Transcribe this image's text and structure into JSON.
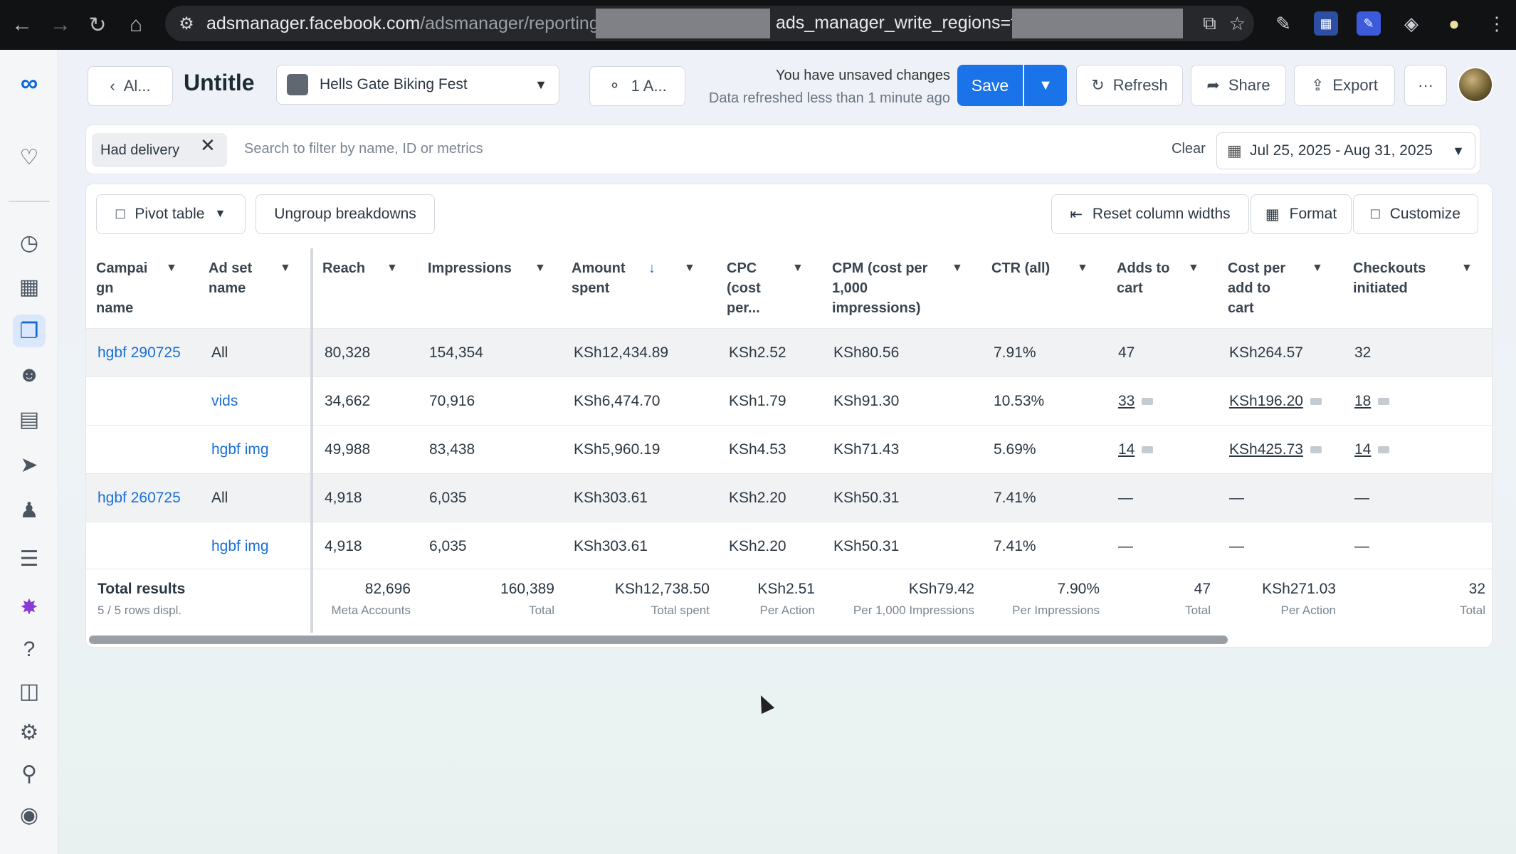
{
  "browser": {
    "url_host": "adsmanager.facebook.com",
    "url_path": "/adsmanager/reporting/view?",
    "url_mid": "ads_manager_write_regions=true"
  },
  "header": {
    "back_label": "Al...",
    "title": "Untitle",
    "campaign_select": "Hells Gate Biking Fest",
    "account_label": "1 A...",
    "unsaved_text": "You have unsaved changes",
    "refreshed_text": "Data refreshed less than 1 minute ago",
    "save_label": "Save",
    "refresh_label": "Refresh",
    "share_label": "Share",
    "export_label": "Export",
    "more_label": "···"
  },
  "filter": {
    "chip_label": "Had delivery",
    "search_placeholder": "Search to filter by name, ID or metrics",
    "clear_label": "Clear",
    "date_range": "Jul 25, 2025 - Aug 31, 2025"
  },
  "toolbar": {
    "pivot_label": "Pivot table",
    "ungroup_label": "Ungroup breakdowns",
    "reset_label": "Reset column widths",
    "format_label": "Format",
    "customize_label": "Customize"
  },
  "columns": [
    "Campai gn name",
    "Ad set name",
    "Reach",
    "Impressions",
    "Amount spent",
    "CPC (cost per...",
    "CPM (cost per 1,000 impressions)",
    "CTR (all)",
    "Adds to cart",
    "Cost per add to cart",
    "Checkouts initiated"
  ],
  "rows": [
    {
      "campaign": "hgbf 290725",
      "adset": "All",
      "reach": "80,328",
      "impressions": "154,354",
      "spent": "KSh12,434.89",
      "cpc": "KSh2.52",
      "cpm": "KSh80.56",
      "ctr": "7.91%",
      "adds": "47",
      "cost_add": "KSh264.57",
      "checkouts": "32"
    },
    {
      "campaign": "",
      "adset": "vids",
      "reach": "34,662",
      "impressions": "70,916",
      "spent": "KSh6,474.70",
      "cpc": "KSh1.79",
      "cpm": "KSh91.30",
      "ctr": "10.53%",
      "adds": "33",
      "cost_add": "KSh196.20",
      "checkouts": "18"
    },
    {
      "campaign": "",
      "adset": "hgbf img",
      "reach": "49,988",
      "impressions": "83,438",
      "spent": "KSh5,960.19",
      "cpc": "KSh4.53",
      "cpm": "KSh71.43",
      "ctr": "5.69%",
      "adds": "14",
      "cost_add": "KSh425.73",
      "checkouts": "14"
    },
    {
      "campaign": "hgbf 260725",
      "adset": "All",
      "reach": "4,918",
      "impressions": "6,035",
      "spent": "KSh303.61",
      "cpc": "KSh2.20",
      "cpm": "KSh50.31",
      "ctr": "7.41%",
      "adds": "—",
      "cost_add": "—",
      "checkouts": "—"
    },
    {
      "campaign": "",
      "adset": "hgbf img",
      "reach": "4,918",
      "impressions": "6,035",
      "spent": "KSh303.61",
      "cpc": "KSh2.20",
      "cpm": "KSh50.31",
      "ctr": "7.41%",
      "adds": "—",
      "cost_add": "—",
      "checkouts": "—"
    }
  ],
  "totals": {
    "title": "Total results",
    "subtitle": "5 / 5 rows displ.",
    "reach": "82,696",
    "reach_lbl": "Meta Accounts",
    "impressions": "160,389",
    "impressions_lbl": "Total",
    "spent": "KSh12,738.50",
    "spent_lbl": "Total spent",
    "cpc": "KSh2.51",
    "cpc_lbl": "Per Action",
    "cpm": "KSh79.42",
    "cpm_lbl": "Per 1,000 Impressions",
    "ctr": "7.90%",
    "ctr_lbl": "Per Impressions",
    "adds": "47",
    "adds_lbl": "Total",
    "cost_add": "KSh271.03",
    "cost_add_lbl": "Per Action",
    "checkouts": "32",
    "checkouts_lbl": "Total"
  },
  "colors": {
    "accent": "#1a73e8",
    "link": "#1a6ed6"
  }
}
